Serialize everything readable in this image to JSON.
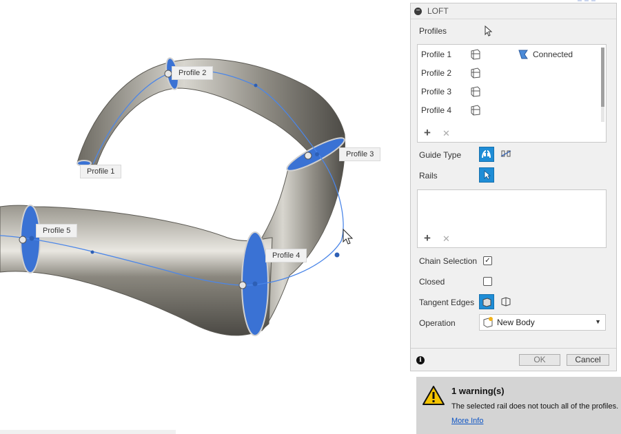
{
  "viewport": {
    "labels": {
      "profile1": "Profile 1",
      "profile2": "Profile 2",
      "profile3": "Profile 3",
      "profile4": "Profile 4",
      "profile5": "Profile 5"
    }
  },
  "loft": {
    "title": "LOFT",
    "profiles_label": "Profiles",
    "profiles": [
      {
        "name": "Profile 1",
        "status": "Connected"
      },
      {
        "name": "Profile 2"
      },
      {
        "name": "Profile 3"
      },
      {
        "name": "Profile 4"
      }
    ],
    "add_symbol": "+",
    "remove_symbol": "✕",
    "guide_type_label": "Guide Type",
    "rails_label": "Rails",
    "chain_selection_label": "Chain Selection",
    "chain_selection_checked": true,
    "closed_label": "Closed",
    "closed_checked": false,
    "tangent_edges_label": "Tangent Edges",
    "operation_label": "Operation",
    "operation_value": "New Body",
    "ok_label": "OK",
    "cancel_label": "Cancel",
    "info_symbol": "i"
  },
  "warning": {
    "title": "1 warning(s)",
    "message": "The selected rail does not touch all of the profiles.",
    "link": "More Info"
  },
  "colors": {
    "accent": "#1f8dd6",
    "profile_fill": "#2f6fd0",
    "rail_line": "#4b86e8",
    "tube": "#7d7a70"
  }
}
